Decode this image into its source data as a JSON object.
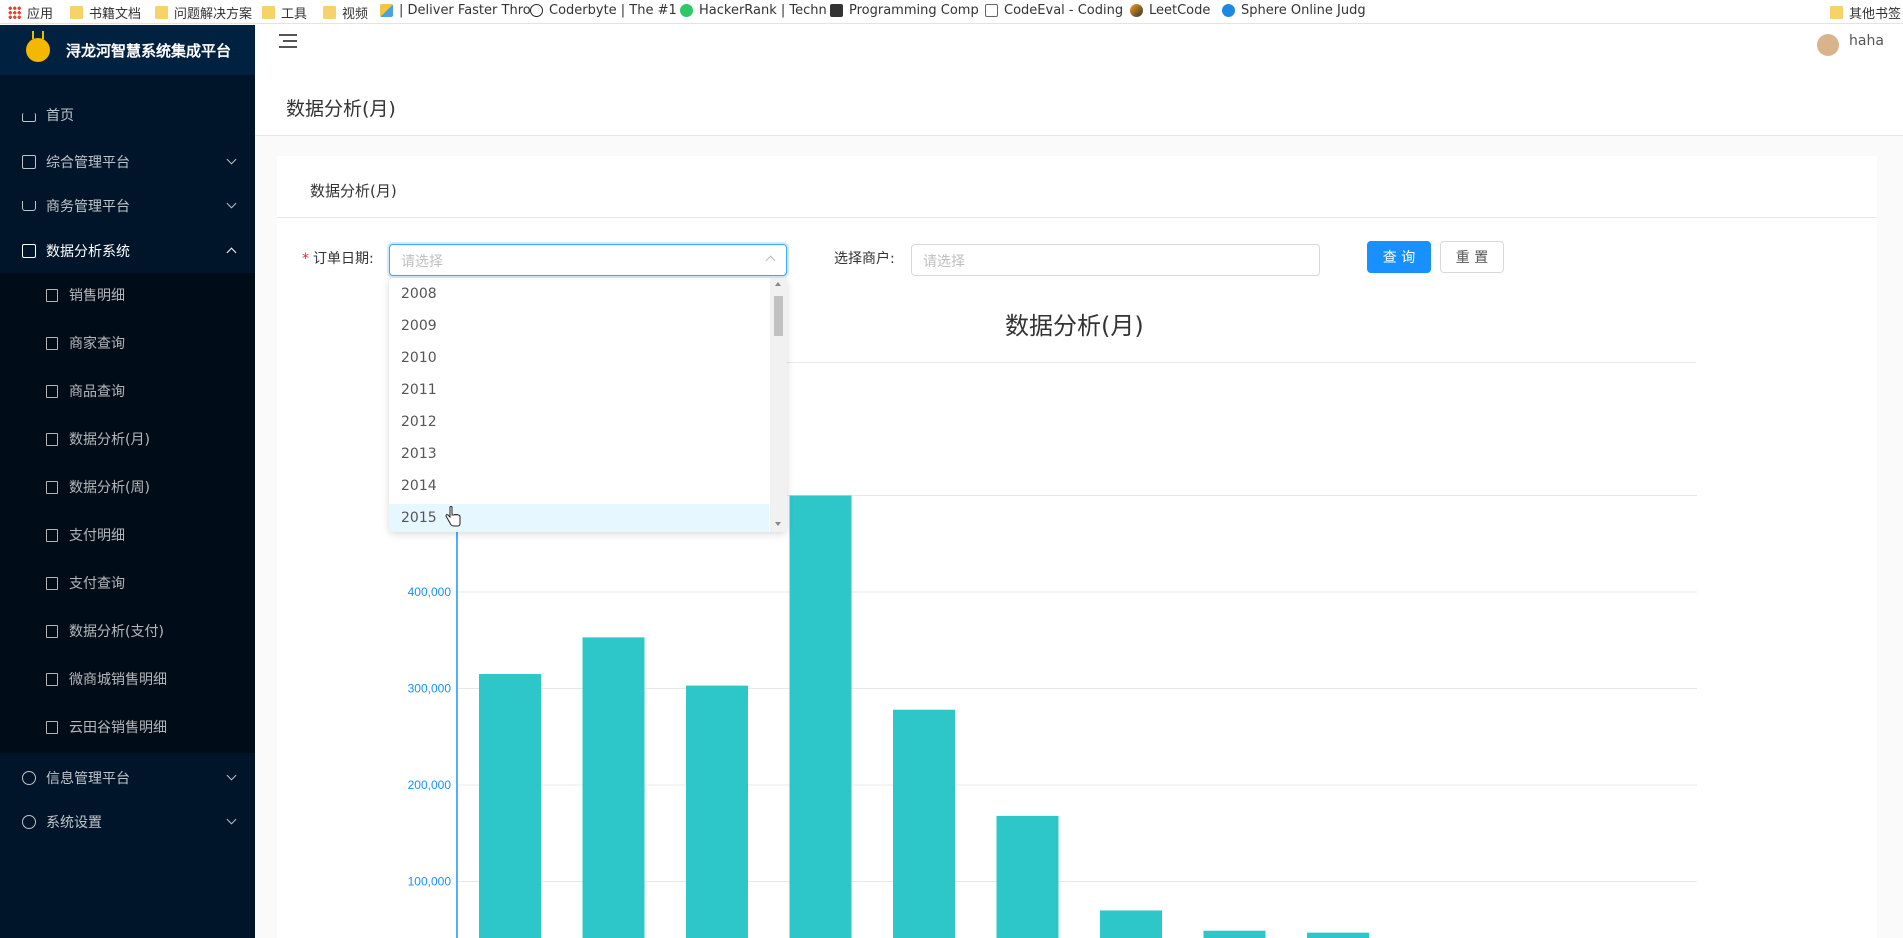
{
  "bookmarks": [
    {
      "label": "应用",
      "icon": "apps"
    },
    {
      "label": "书籍文档",
      "icon": "folder"
    },
    {
      "label": "问题解决方案",
      "icon": "folder"
    },
    {
      "label": "工具",
      "icon": "folder"
    },
    {
      "label": "视频",
      "icon": "folder"
    },
    {
      "label": "| Deliver Faster Thro",
      "icon": "flag"
    },
    {
      "label": "Coderbyte | The #1",
      "icon": "cb"
    },
    {
      "label": "HackerRank | Techn",
      "icon": "green"
    },
    {
      "label": "Programming Comp",
      "icon": "dark"
    },
    {
      "label": "CodeEval - Coding",
      "icon": "doc"
    },
    {
      "label": "LeetCode",
      "icon": "lc"
    },
    {
      "label": "Sphere Online Judg",
      "icon": "blue"
    },
    {
      "label": "其他书签",
      "icon": "folder"
    }
  ],
  "sidebar": {
    "brand": "浔龙河智慧系统集成平台",
    "menu": [
      {
        "label": "首页",
        "icon": "home-icon"
      },
      {
        "label": "综合管理平台",
        "icon": "list-icon"
      },
      {
        "label": "商务管理平台",
        "icon": "cart-icon"
      },
      {
        "label": "数据分析系统",
        "icon": "list-icon"
      },
      {
        "label": "信息管理平台",
        "icon": "info-icon"
      },
      {
        "label": "系统设置",
        "icon": "gear-icon"
      }
    ],
    "submenu": [
      {
        "label": "销售明细"
      },
      {
        "label": "商家查询"
      },
      {
        "label": "商品查询"
      },
      {
        "label": "数据分析(月)"
      },
      {
        "label": "数据分析(周)"
      },
      {
        "label": "支付明细"
      },
      {
        "label": "支付查询"
      },
      {
        "label": "数据分析(支付)"
      },
      {
        "label": "微商城销售明细"
      },
      {
        "label": "云田谷销售明细"
      }
    ]
  },
  "header": {
    "username": "haha"
  },
  "page": {
    "title": "数据分析(月)",
    "card_title": "数据分析(月)"
  },
  "form": {
    "order_date_label": "订单日期:",
    "order_date_placeholder": "请选择",
    "merchant_label": "选择商户:",
    "merchant_placeholder": "请选择",
    "query_label": "查 询",
    "reset_label": "重 置"
  },
  "dropdown": {
    "options": [
      "2008",
      "2009",
      "2010",
      "2011",
      "2012",
      "2013",
      "2014",
      "2015"
    ],
    "hovered": "2015"
  },
  "chart_data": {
    "type": "bar",
    "title": "数据分析(月)",
    "color": "#2ec7c9",
    "y_tick_labels": [
      "100,000",
      "200,000",
      "300,000",
      "400,000"
    ],
    "ylim": [
      0,
      500000
    ],
    "values": [
      315000,
      353000,
      303000,
      500000,
      278000,
      168000,
      70000,
      49000,
      47000
    ]
  }
}
